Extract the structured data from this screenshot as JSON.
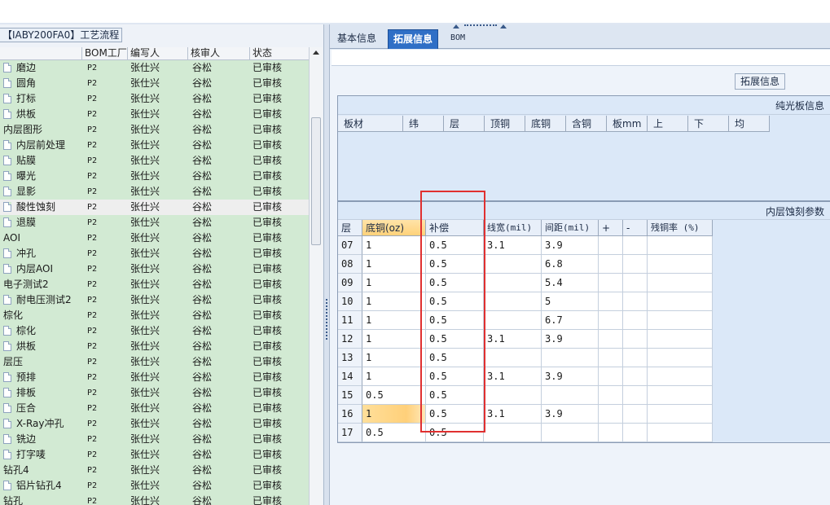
{
  "left_panel": {
    "title": "【IABY200FA0】工艺流程",
    "columns": [
      "BOM工厂",
      "编写人",
      "核审人",
      "状态"
    ],
    "rows": [
      {
        "name": "磨边",
        "child": true,
        "bom": "P2",
        "writer": "张仕兴",
        "reviewer": "谷松",
        "status": "已审核"
      },
      {
        "name": "圆角",
        "child": true,
        "bom": "P2",
        "writer": "张仕兴",
        "reviewer": "谷松",
        "status": "已审核"
      },
      {
        "name": "打标",
        "child": true,
        "bom": "P2",
        "writer": "张仕兴",
        "reviewer": "谷松",
        "status": "已审核"
      },
      {
        "name": "烘板",
        "child": true,
        "bom": "P2",
        "writer": "张仕兴",
        "reviewer": "谷松",
        "status": "已审核"
      },
      {
        "name": "内层图形",
        "child": false,
        "bom": "P2",
        "writer": "张仕兴",
        "reviewer": "谷松",
        "status": "已审核"
      },
      {
        "name": "内层前处理",
        "child": true,
        "bom": "P2",
        "writer": "张仕兴",
        "reviewer": "谷松",
        "status": "已审核"
      },
      {
        "name": "贴膜",
        "child": true,
        "bom": "P2",
        "writer": "张仕兴",
        "reviewer": "谷松",
        "status": "已审核"
      },
      {
        "name": "曝光",
        "child": true,
        "bom": "P2",
        "writer": "张仕兴",
        "reviewer": "谷松",
        "status": "已审核"
      },
      {
        "name": "显影",
        "child": true,
        "bom": "P2",
        "writer": "张仕兴",
        "reviewer": "谷松",
        "status": "已审核"
      },
      {
        "name": "酸性蚀刻",
        "child": true,
        "bom": "P2",
        "writer": "张仕兴",
        "reviewer": "谷松",
        "status": "已审核",
        "selected": true
      },
      {
        "name": "退膜",
        "child": true,
        "bom": "P2",
        "writer": "张仕兴",
        "reviewer": "谷松",
        "status": "已审核"
      },
      {
        "name": "AOI",
        "child": false,
        "bom": "P2",
        "writer": "张仕兴",
        "reviewer": "谷松",
        "status": "已审核"
      },
      {
        "name": "冲孔",
        "child": true,
        "bom": "P2",
        "writer": "张仕兴",
        "reviewer": "谷松",
        "status": "已审核"
      },
      {
        "name": "内层AOI",
        "child": true,
        "bom": "P2",
        "writer": "张仕兴",
        "reviewer": "谷松",
        "status": "已审核"
      },
      {
        "name": "电子测试2",
        "child": false,
        "bom": "P2",
        "writer": "张仕兴",
        "reviewer": "谷松",
        "status": "已审核"
      },
      {
        "name": "耐电压测试2",
        "child": true,
        "bom": "P2",
        "writer": "张仕兴",
        "reviewer": "谷松",
        "status": "已审核"
      },
      {
        "name": "棕化",
        "child": false,
        "bom": "P2",
        "writer": "张仕兴",
        "reviewer": "谷松",
        "status": "已审核"
      },
      {
        "name": "棕化",
        "child": true,
        "bom": "P2",
        "writer": "张仕兴",
        "reviewer": "谷松",
        "status": "已审核"
      },
      {
        "name": "烘板",
        "child": true,
        "bom": "P2",
        "writer": "张仕兴",
        "reviewer": "谷松",
        "status": "已审核"
      },
      {
        "name": "层压",
        "child": false,
        "bom": "P2",
        "writer": "张仕兴",
        "reviewer": "谷松",
        "status": "已审核"
      },
      {
        "name": "预排",
        "child": true,
        "bom": "P2",
        "writer": "张仕兴",
        "reviewer": "谷松",
        "status": "已审核"
      },
      {
        "name": "排板",
        "child": true,
        "bom": "P2",
        "writer": "张仕兴",
        "reviewer": "谷松",
        "status": "已审核"
      },
      {
        "name": "压合",
        "child": true,
        "bom": "P2",
        "writer": "张仕兴",
        "reviewer": "谷松",
        "status": "已审核"
      },
      {
        "name": "X-Ray冲孔",
        "child": true,
        "bom": "P2",
        "writer": "张仕兴",
        "reviewer": "谷松",
        "status": "已审核"
      },
      {
        "name": "铣边",
        "child": true,
        "bom": "P2",
        "writer": "张仕兴",
        "reviewer": "谷松",
        "status": "已审核"
      },
      {
        "name": "打字唛",
        "child": true,
        "bom": "P2",
        "writer": "张仕兴",
        "reviewer": "谷松",
        "status": "已审核"
      },
      {
        "name": "钻孔4",
        "child": false,
        "bom": "P2",
        "writer": "张仕兴",
        "reviewer": "谷松",
        "status": "已审核"
      },
      {
        "name": "铝片钻孔4",
        "child": true,
        "bom": "P2",
        "writer": "张仕兴",
        "reviewer": "谷松",
        "status": "已审核"
      },
      {
        "name": "钻孔",
        "child": false,
        "bom": "P2",
        "writer": "张仕兴",
        "reviewer": "谷松",
        "status": "已审核"
      }
    ]
  },
  "tabs": [
    {
      "label": "基本信息",
      "active": false
    },
    {
      "label": "拓展信息",
      "active": true
    },
    {
      "label": "BOM",
      "active": false
    }
  ],
  "ext_label": "拓展信息",
  "section_bare": {
    "title": "纯光板信息",
    "columns": [
      "板材",
      "纬",
      "层",
      "顶铜",
      "底铜",
      "含铜",
      "板mm",
      "上",
      "下",
      "均"
    ]
  },
  "section_etch": {
    "title": "内层蚀刻参数",
    "columns": [
      "层",
      "底铜(oz)",
      "补偿",
      "线宽(mil)",
      "间距(mil)",
      "+",
      "-",
      "残铜率 (%)"
    ],
    "rows": [
      [
        "07",
        "1",
        "0.5",
        "3.1",
        "3.9",
        "",
        "",
        ""
      ],
      [
        "08",
        "1",
        "0.5",
        "",
        "6.8",
        "",
        "",
        ""
      ],
      [
        "09",
        "1",
        "0.5",
        "",
        "5.4",
        "",
        "",
        ""
      ],
      [
        "10",
        "1",
        "0.5",
        "",
        "5",
        "",
        "",
        ""
      ],
      [
        "11",
        "1",
        "0.5",
        "",
        "6.7",
        "",
        "",
        ""
      ],
      [
        "12",
        "1",
        "0.5",
        "3.1",
        "3.9",
        "",
        "",
        ""
      ],
      [
        "13",
        "1",
        "0.5",
        "",
        "",
        "",
        "",
        ""
      ],
      [
        "14",
        "1",
        "0.5",
        "3.1",
        "3.9",
        "",
        "",
        ""
      ],
      [
        "15",
        "0.5",
        "0.5",
        "",
        "",
        "",
        "",
        ""
      ],
      [
        "16",
        "1",
        "0.5",
        "3.1",
        "3.9",
        "",
        "",
        ""
      ],
      [
        "17",
        "0.5",
        "0.5",
        "",
        "",
        "",
        "",
        ""
      ]
    ],
    "highlighted_row": 9
  },
  "colors": {
    "list_bg": "#d2ead3",
    "tab_active": "#2f6fc6",
    "cell_highlight": "#ffd07a",
    "red_box": "#e03030"
  }
}
